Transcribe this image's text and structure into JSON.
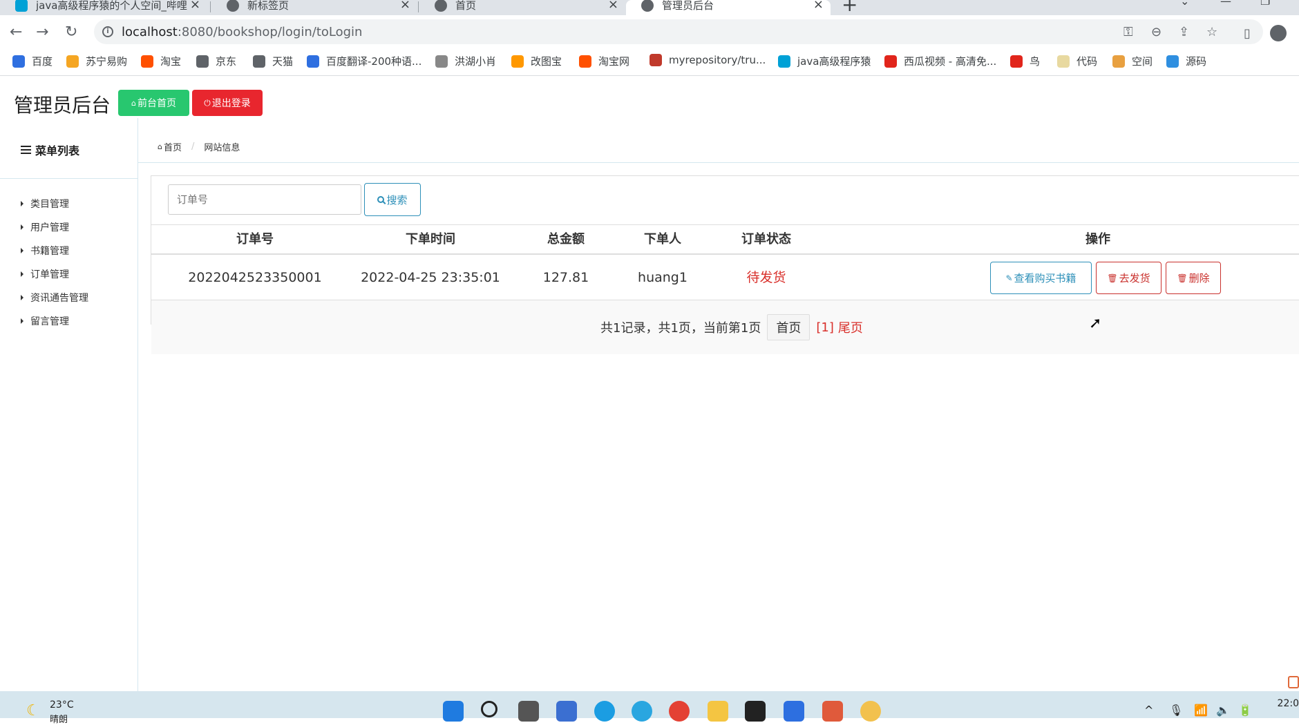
{
  "browser": {
    "tabs": [
      {
        "label": "java高级程序猿的个人空间_哔哩",
        "favicon": "bilibili-icon"
      },
      {
        "label": "新标签页",
        "favicon": "globe-icon"
      },
      {
        "label": "首页",
        "favicon": "globe-icon"
      },
      {
        "label": "管理员后台",
        "favicon": "globe-icon",
        "active": true
      }
    ],
    "url_host": "localhost",
    "url_rest": ":8080/bookshop/login/toLogin",
    "bookmarks": [
      {
        "label": "百度",
        "color": "#2f6fe0"
      },
      {
        "label": "苏宁易购",
        "color": "#f5a623"
      },
      {
        "label": "淘宝",
        "color": "#ff5000"
      },
      {
        "label": "京东",
        "color": "#5f6368"
      },
      {
        "label": "天猫",
        "color": "#5f6368"
      },
      {
        "label": "百度翻译-200种语...",
        "color": "#2f6fe0"
      },
      {
        "label": "洪湖小肖",
        "color": "#888888"
      },
      {
        "label": "改图宝",
        "color": "#ff9800"
      },
      {
        "label": "淘宝网",
        "color": "#ff5000"
      },
      {
        "label": "myrepository/tru...",
        "color": "#c0392b"
      },
      {
        "label": "java高级程序猿",
        "color": "#00a1d6"
      },
      {
        "label": "西瓜视频 - 高清免...",
        "color": "#e1251b"
      },
      {
        "label": "鸟",
        "color": "#e1251b"
      },
      {
        "label": "代码",
        "color": "#e8d9a0"
      },
      {
        "label": "空间",
        "color": "#e8a040"
      },
      {
        "label": "源码",
        "color": "#2f8fe0"
      }
    ]
  },
  "header": {
    "title": "管理员后台",
    "front_button": "前台首页",
    "logout_button": "退出登录"
  },
  "sidebar": {
    "title": "菜单列表",
    "items": [
      "类目管理",
      "用户管理",
      "书籍管理",
      "订单管理",
      "资讯通告管理",
      "留言管理"
    ]
  },
  "breadcrumb": {
    "home": "首页",
    "current": "网站信息"
  },
  "search": {
    "placeholder": "订单号",
    "button": "搜索"
  },
  "table": {
    "headers": [
      "订单号",
      "下单时间",
      "总金额",
      "下单人",
      "订单状态",
      "操作"
    ],
    "rows": [
      {
        "order_no": "2022042523350001",
        "time": "2022-04-25 23:35:01",
        "amount": "127.81",
        "user": "huang1",
        "status": "待发货",
        "actions": [
          "查看购买书籍",
          "去发货",
          "删除"
        ]
      }
    ]
  },
  "pager": {
    "summary": "共1记录，共1页，当前第1页",
    "first": "首页",
    "current": "[1]",
    "last": "尾页"
  },
  "taskbar": {
    "temperature": "23°C",
    "weather": "晴朗",
    "time": "22:0"
  },
  "colors": {
    "green": "#28c76f",
    "red": "#e8262e",
    "blue": "#2c8fb8",
    "status_red": "#d9302b"
  }
}
